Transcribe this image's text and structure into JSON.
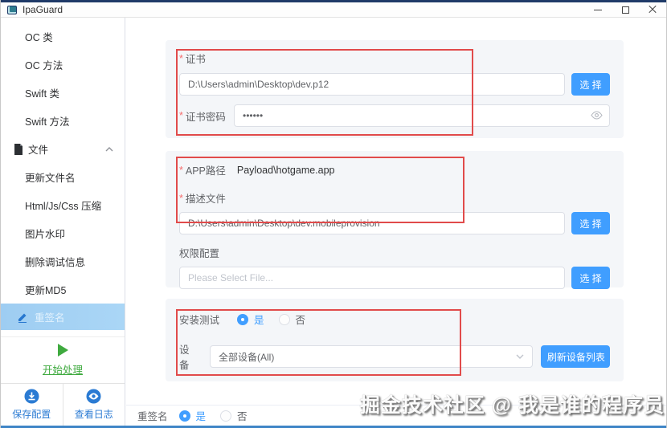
{
  "window": {
    "title": "IpaGuard"
  },
  "sidebar": {
    "items": [
      {
        "label": "OC 类"
      },
      {
        "label": "OC 方法"
      },
      {
        "label": "Swift 类"
      },
      {
        "label": "Swift 方法"
      },
      {
        "label": "文件"
      },
      {
        "label": "更新文件名"
      },
      {
        "label": "Html/Js/Css 压缩"
      },
      {
        "label": "图片水印"
      },
      {
        "label": "删除调试信息"
      },
      {
        "label": "更新MD5"
      },
      {
        "label": "重签名"
      }
    ],
    "start_label": "开始处理",
    "save_config_label": "保存配置",
    "view_log_label": "查看日志"
  },
  "form": {
    "required_marker": "*",
    "certificate": {
      "label": "证书",
      "value": "D:\\Users\\admin\\Desktop\\dev.p12",
      "select_label": "选 择"
    },
    "cert_password": {
      "label": "证书密码",
      "value": "••••••"
    },
    "app_path": {
      "label": "APP路径",
      "value": "Payload\\hotgame.app"
    },
    "profile": {
      "label": "描述文件",
      "value": "D:\\Users\\admin\\Desktop\\dev.mobileprovision",
      "select_label": "选 择"
    },
    "entitlements": {
      "label": "权限配置",
      "placeholder": "Please Select File...",
      "select_label": "选 择"
    },
    "install_test": {
      "label": "安装测试",
      "yes": "是",
      "no": "否",
      "selected": "是"
    },
    "device": {
      "label": "设备",
      "value": "全部设备(All)",
      "refresh_label": "刷新设备列表"
    },
    "resign": {
      "label": "重签名",
      "yes": "是",
      "no": "否",
      "selected": "是"
    }
  },
  "watermark": "掘金技术社区 @ 我是谁的程序员",
  "colors": {
    "primary": "#409eff",
    "annotation": "#e14b4b",
    "selected_sidebar_bg": "#a3d3f7",
    "start_green": "#3faa3f",
    "footer_blue": "#2b7bd3"
  }
}
